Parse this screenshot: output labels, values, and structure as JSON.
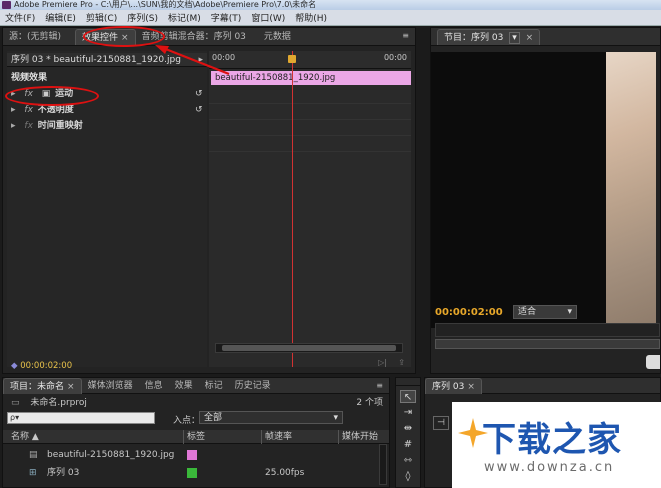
{
  "window": {
    "title": "Adobe Premiere Pro - C:\\用户\\...\\SUN\\我的文档\\Adobe\\Premiere Pro\\7.0\\未命名"
  },
  "menu": [
    "文件(F)",
    "编辑(E)",
    "剪辑(C)",
    "序列(S)",
    "标记(M)",
    "字幕(T)",
    "窗口(W)",
    "帮助(H)"
  ],
  "source_panel": {
    "tabs": [
      {
        "label": "源：(无剪辑)"
      },
      {
        "label": "效果控件",
        "close": "×",
        "active": true
      },
      {
        "label": "音频剪辑混合器：序列 03"
      },
      {
        "label": "元数据"
      }
    ],
    "menu_icon": "≡"
  },
  "effect_controls": {
    "sequence_label": "序列 03 * beautiful-2150881_1920.jpg",
    "ruler_start": "00:00",
    "ruler_end": "00:00",
    "clip_name": "beautiful-2150881_1920.jpg",
    "section_header": "视频效果",
    "effects": [
      {
        "label": "运动",
        "fx": "fx",
        "reset": "↺"
      },
      {
        "label": "不透明度",
        "fx": "fx",
        "reset": "↺"
      },
      {
        "label": "时间重映射",
        "fx": "fx",
        "reset": ""
      }
    ],
    "current_time": "00:00:02:00",
    "playhead_fraction": 0.41,
    "clip_color": "#eba7e6",
    "annotation_color": "#d11111"
  },
  "program_monitor": {
    "tab_label": "节目：序列 03",
    "dropdown_arrow": "▾",
    "close": "×",
    "timecode": "00:00:02:00",
    "fit_label": "适合"
  },
  "project_panel": {
    "tabs": [
      {
        "label": "项目：未命名",
        "close": "×",
        "active": true
      },
      {
        "label": "媒体浏览器"
      },
      {
        "label": "信息"
      },
      {
        "label": "效果"
      },
      {
        "label": "标记"
      },
      {
        "label": "历史记录"
      }
    ],
    "project_file": "未命名.prproj",
    "item_count": "2 个项",
    "search_placeholder": "ρ▾",
    "in_point_label": "入点：",
    "in_point_value": "全部",
    "columns": [
      "名称 ▲",
      "标签",
      "帧速率",
      "媒体开始"
    ],
    "items": [
      {
        "name": "beautiful-2150881_1920.jpg",
        "label_color": "#e077d6",
        "framerate": ""
      },
      {
        "name": "序列 03",
        "label_color": "#3ab83a",
        "framerate": "25.00fps"
      }
    ]
  },
  "timeline_panel": {
    "tab_label": "序列 03",
    "close": "×"
  },
  "tools": [
    "arrow-tool",
    "track-select-tool",
    "ripple-edit-tool",
    "rolling-edit-tool",
    "rate-stretch-tool",
    "razor-tool"
  ],
  "watermark": {
    "title": "下载之家",
    "url": "www.downza.cn"
  }
}
